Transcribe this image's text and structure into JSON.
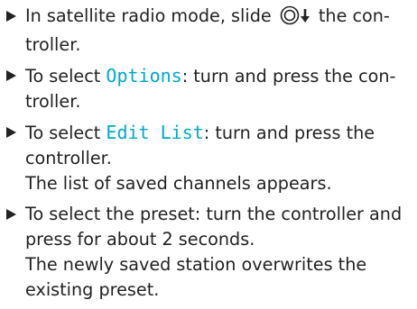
{
  "accent_color": "#00a9c9",
  "steps": [
    {
      "pre": "In satellite radio mode, slide ",
      "icon": "controller-slide-down-icon",
      "post": " the con-",
      "post2": "troller."
    },
    {
      "pre": "To select ",
      "term": "Options",
      "post": ": turn and press the con-",
      "post2": "troller."
    },
    {
      "pre": "To select ",
      "term": "Edit List",
      "post": ": turn and press the",
      "post2": "controller.",
      "result": "The list of saved channels appears."
    },
    {
      "line1": "To select the preset: turn the controller and",
      "line2": "press for about 2 seconds.",
      "result1": "The newly saved station overwrites the",
      "result2": "existing preset."
    }
  ]
}
